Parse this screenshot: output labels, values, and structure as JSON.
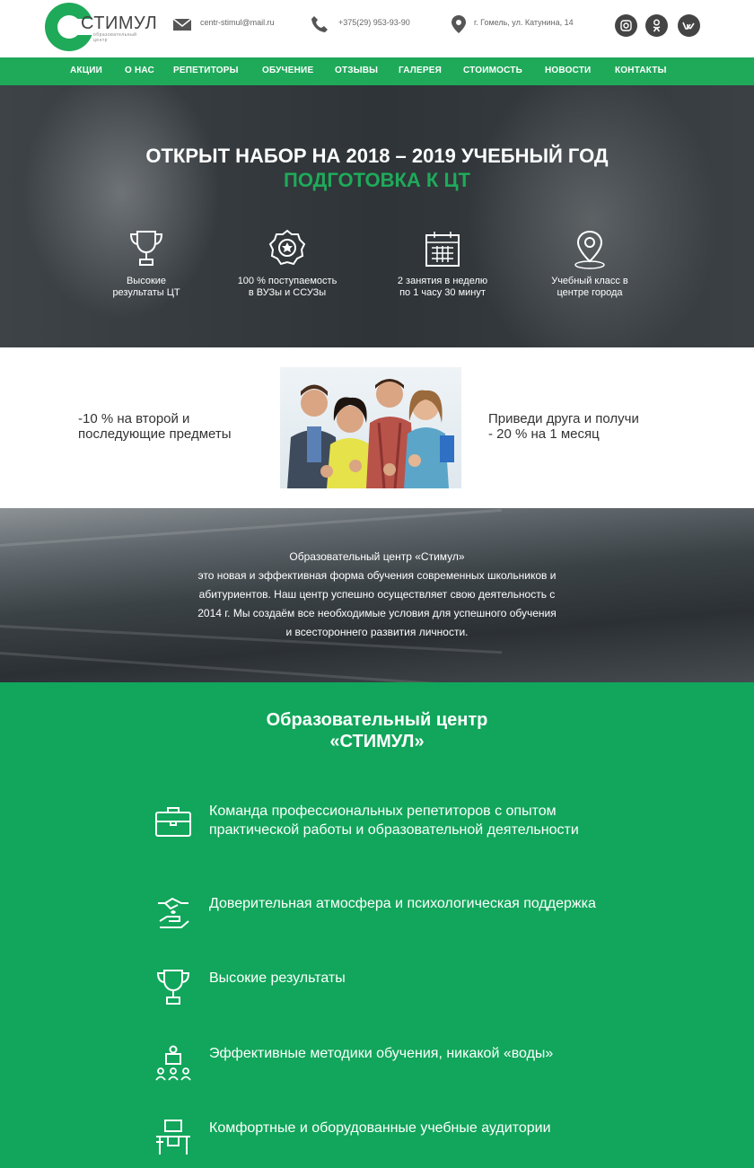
{
  "header": {
    "logo_name": "СТИМУЛ",
    "logo_sub": "образовательный центр",
    "email": "centr-stimul@mail.ru",
    "phone": "+375(29) 953-93-90",
    "address": "г. Гомель, ул. Катунина, 14",
    "social": [
      "instagram-icon",
      "odnoklassniki-icon",
      "vk-icon"
    ]
  },
  "nav": [
    "АКЦИИ",
    "О НАС",
    "РЕПЕТИТОРЫ",
    "ОБУЧЕНИЕ",
    "ОТЗЫВЫ",
    "ГАЛЕРЕЯ",
    "СТОИМОСТЬ",
    "НОВОСТИ",
    "КОНТАКТЫ"
  ],
  "hero": {
    "title": "ОТКРЫТ НАБОР НА 2018 – 2019 УЧЕБНЫЙ ГОД",
    "subtitle": "ПОДГОТОВКА К ЦТ",
    "features": [
      {
        "icon": "trophy-icon",
        "line1": "Высокие",
        "line2": "результаты ЦТ"
      },
      {
        "icon": "award-icon",
        "line1": "100 % поступаемость",
        "line2": "в ВУЗы и ССУЗы"
      },
      {
        "icon": "calendar-icon",
        "line1": "2 занятия в неделю",
        "line2": "по 1 часу 30 минут"
      },
      {
        "icon": "location-icon",
        "line1": "Учебный класс в",
        "line2": "центре города"
      }
    ]
  },
  "offers": {
    "left_line1": "-10 % на второй и",
    "left_line2": "последующие предметы",
    "right_line1": "Приведи друга и получи",
    "right_line2": "- 20 % на 1 месяц"
  },
  "about": {
    "lines": [
      "Образовательный центр «Стимул»",
      "это новая и эффективная форма обучения современных школьников и",
      "абитуриентов. Наш центр успешно осуществляет свою деятельность с",
      "2014 г. Мы создаём все необходимые условия для успешного обучения",
      "и всестороннего развития личности."
    ]
  },
  "benefits": {
    "title_line1": "Образовательный центр",
    "title_line2": "«СТИМУЛ»",
    "items": [
      {
        "icon": "briefcase-icon",
        "text": "Команда профессиональных репетиторов с опытом практической работы и образовательной деятельности"
      },
      {
        "icon": "handshake-icon",
        "text": "Доверительная атмосфера и психологическая поддержка"
      },
      {
        "icon": "trophy-icon",
        "text": "Высокие результаты"
      },
      {
        "icon": "presentation-icon",
        "text": "Эффективные методики обучения, никакой «воды»"
      },
      {
        "icon": "desk-icon",
        "text": "Комфортные и оборудованные учебные аудитории"
      }
    ]
  },
  "colors": {
    "accent": "#1faa5a",
    "green_bg": "#11a65b",
    "dark": "#2e3437"
  }
}
